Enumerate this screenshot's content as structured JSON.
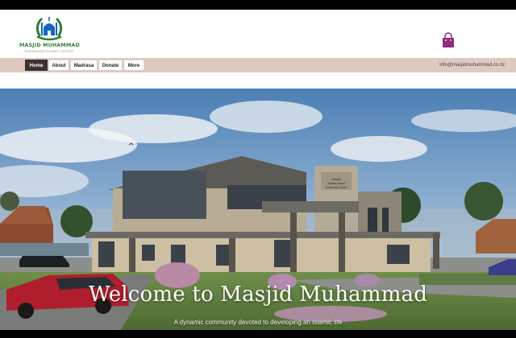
{
  "header": {
    "logo_title": "MASJID MUHAMMAD",
    "logo_subtitle": "PAKURANGA ISLAMIC CENTRE",
    "cart_icon": "shopping-bag-icon"
  },
  "nav": {
    "items": [
      {
        "label": "Home",
        "active": true
      },
      {
        "label": "About",
        "active": false
      },
      {
        "label": "Madrasa",
        "active": false
      },
      {
        "label": "Donate",
        "active": false
      },
      {
        "label": "More",
        "active": false
      }
    ],
    "email": "info@masjidmuhammad.co.nz"
  },
  "hero": {
    "title": "Welcome to Masjid Muhammad",
    "subtitle": "A dynamic community devoted to developing an Islamic life",
    "building_sign": "Masjid Muhammad Community Centre"
  },
  "colors": {
    "brand_green": "#2e7d32",
    "nav_bg": "#decac0",
    "nav_active": "#3a3432",
    "cart_purple": "#8e2d7b"
  }
}
